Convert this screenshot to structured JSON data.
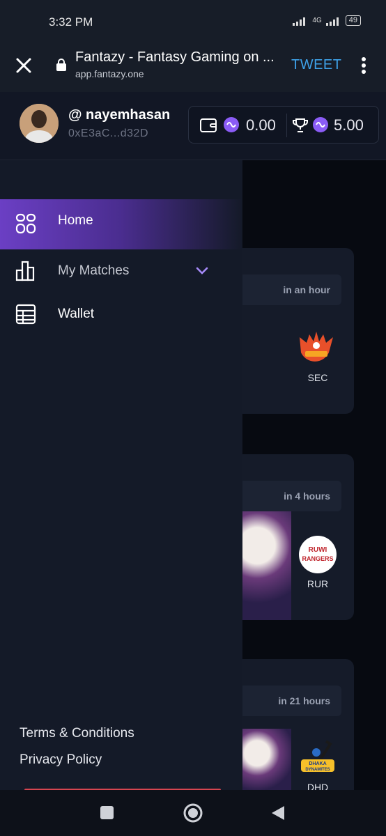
{
  "status_bar": {
    "time": "3:32 PM",
    "network": "4G",
    "battery": "49"
  },
  "browser": {
    "title": "Fantazy - Fantasy Gaming on ...",
    "url": "app.fantazy.one",
    "tweet_label": "TWEET"
  },
  "user": {
    "username": "@ nayemhasan",
    "address": "0xE3aC...d32D"
  },
  "balances": {
    "wallet": "0.00",
    "rewards": "5.00"
  },
  "drawer": {
    "items": [
      {
        "label": "Home",
        "icon": "home-grid-icon",
        "active": true
      },
      {
        "label": "My Matches",
        "icon": "bar-chart-icon",
        "active": false
      },
      {
        "label": "Wallet",
        "icon": "table-icon",
        "active": false
      }
    ],
    "footer": {
      "terms": "Terms & Conditions",
      "privacy": "Privacy Policy"
    }
  },
  "matches": [
    {
      "time": "in an hour",
      "team": "SEC"
    },
    {
      "time": "in 4 hours",
      "team": "RUR",
      "logo_text": [
        "RUWI",
        "RANGERS"
      ]
    },
    {
      "time": "in 21 hours",
      "team": "DHD",
      "logo_text": [
        "DHAKA",
        "DYNAMITES"
      ]
    }
  ],
  "colors": {
    "accent": "#6b3fc4",
    "tweet": "#3ea1e8",
    "coin": "#8b5cf6"
  }
}
